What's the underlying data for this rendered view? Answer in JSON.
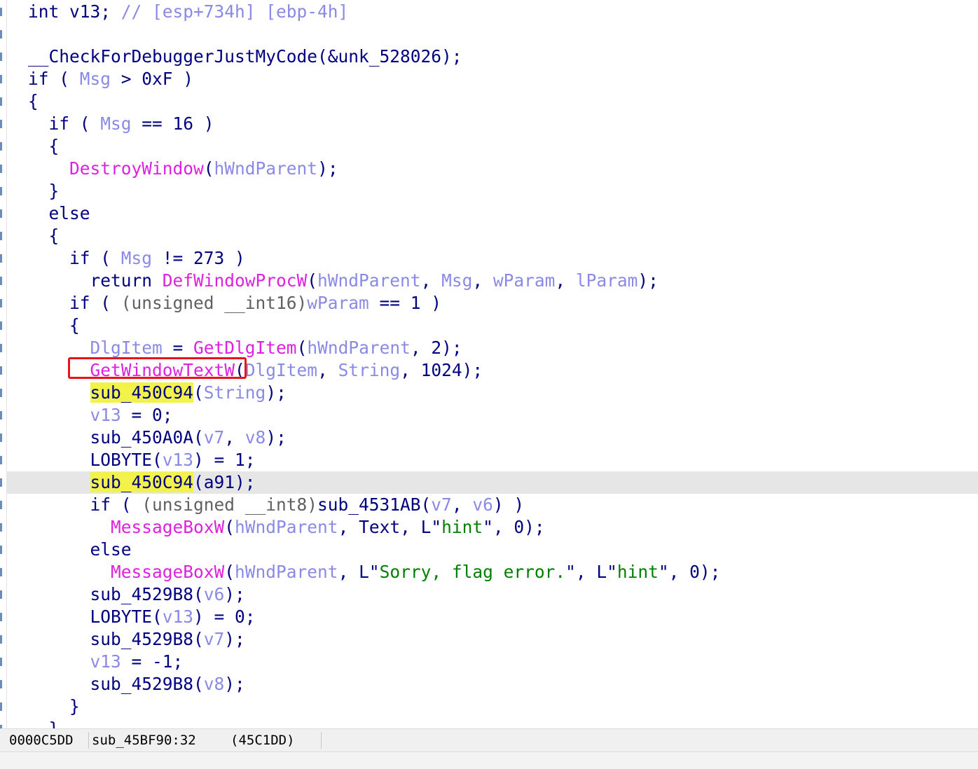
{
  "pseudocode": {
    "lines": [
      {
        "tokens": [
          {
            "t": "int v13; ",
            "c": "kw"
          },
          {
            "t": "// [esp+734h] [ebp-4h]",
            "c": "comment"
          }
        ]
      },
      {
        "tokens": []
      },
      {
        "tokens": [
          {
            "t": "__CheckForDebuggerJustMyCode(&unk_528026);",
            "c": "name"
          }
        ]
      },
      {
        "tokens": [
          {
            "t": "if ( ",
            "c": "kw"
          },
          {
            "t": "Msg",
            "c": "local"
          },
          {
            "t": " > 0xF )",
            "c": "kw"
          }
        ]
      },
      {
        "tokens": [
          {
            "t": "{",
            "c": "kw"
          }
        ]
      },
      {
        "tokens": [
          {
            "t": "  if ( ",
            "c": "kw"
          },
          {
            "t": "Msg",
            "c": "local"
          },
          {
            "t": " == 16 )",
            "c": "kw"
          }
        ]
      },
      {
        "tokens": [
          {
            "t": "  {",
            "c": "kw"
          }
        ]
      },
      {
        "tokens": [
          {
            "t": "    ",
            "c": "kw"
          },
          {
            "t": "DestroyWindow",
            "c": "func"
          },
          {
            "t": "(",
            "c": "kw"
          },
          {
            "t": "hWndParent",
            "c": "local"
          },
          {
            "t": ");",
            "c": "kw"
          }
        ]
      },
      {
        "tokens": [
          {
            "t": "  }",
            "c": "kw"
          }
        ]
      },
      {
        "tokens": [
          {
            "t": "  else",
            "c": "kw"
          }
        ]
      },
      {
        "tokens": [
          {
            "t": "  {",
            "c": "kw"
          }
        ]
      },
      {
        "tokens": [
          {
            "t": "    if ( ",
            "c": "kw"
          },
          {
            "t": "Msg",
            "c": "local"
          },
          {
            "t": " != 273 )",
            "c": "kw"
          }
        ]
      },
      {
        "tokens": [
          {
            "t": "      return ",
            "c": "kw"
          },
          {
            "t": "DefWindowProcW",
            "c": "func"
          },
          {
            "t": "(",
            "c": "kw"
          },
          {
            "t": "hWndParent",
            "c": "local"
          },
          {
            "t": ", ",
            "c": "kw"
          },
          {
            "t": "Msg",
            "c": "local"
          },
          {
            "t": ", ",
            "c": "kw"
          },
          {
            "t": "wParam",
            "c": "local"
          },
          {
            "t": ", ",
            "c": "kw"
          },
          {
            "t": "lParam",
            "c": "local"
          },
          {
            "t": ");",
            "c": "kw"
          }
        ]
      },
      {
        "tokens": [
          {
            "t": "    if ( ",
            "c": "kw"
          },
          {
            "t": "(unsigned __int16)",
            "c": "type"
          },
          {
            "t": "wParam",
            "c": "local"
          },
          {
            "t": " == 1 )",
            "c": "kw"
          }
        ]
      },
      {
        "tokens": [
          {
            "t": "    {",
            "c": "kw"
          }
        ]
      },
      {
        "tokens": [
          {
            "t": "      ",
            "c": "kw"
          },
          {
            "t": "DlgItem",
            "c": "local"
          },
          {
            "t": " = ",
            "c": "kw"
          },
          {
            "t": "GetDlgItem",
            "c": "func"
          },
          {
            "t": "(",
            "c": "kw"
          },
          {
            "t": "hWndParent",
            "c": "local"
          },
          {
            "t": ", 2);",
            "c": "kw"
          }
        ]
      },
      {
        "tokens": [
          {
            "t": "      ",
            "c": "kw"
          },
          {
            "t": "GetWindowTextW",
            "c": "func"
          },
          {
            "t": "(",
            "c": "kw"
          },
          {
            "t": "DlgItem",
            "c": "local"
          },
          {
            "t": ", ",
            "c": "kw"
          },
          {
            "t": "String",
            "c": "local"
          },
          {
            "t": ", 1024);",
            "c": "kw"
          }
        ]
      },
      {
        "tokens": [
          {
            "t": "      ",
            "c": "kw"
          },
          {
            "t": "sub_450C94",
            "c": "hl"
          },
          {
            "t": "(",
            "c": "kw"
          },
          {
            "t": "String",
            "c": "local"
          },
          {
            "t": ");",
            "c": "kw"
          }
        ]
      },
      {
        "tokens": [
          {
            "t": "      ",
            "c": "kw"
          },
          {
            "t": "v13",
            "c": "local"
          },
          {
            "t": " = 0;",
            "c": "kw"
          }
        ]
      },
      {
        "tokens": [
          {
            "t": "      sub_450A0A(",
            "c": "kw"
          },
          {
            "t": "v7",
            "c": "local"
          },
          {
            "t": ", ",
            "c": "kw"
          },
          {
            "t": "v8",
            "c": "local"
          },
          {
            "t": ");",
            "c": "kw"
          }
        ]
      },
      {
        "tokens": [
          {
            "t": "      LOBYTE(",
            "c": "kw"
          },
          {
            "t": "v13",
            "c": "local"
          },
          {
            "t": ") = 1;",
            "c": "kw"
          }
        ]
      },
      {
        "tokens": [
          {
            "t": "      ",
            "c": "kw"
          },
          {
            "t": "sub_450C94",
            "c": "hl"
          },
          {
            "t": "(a91);",
            "c": "kw"
          }
        ],
        "current": true
      },
      {
        "tokens": [
          {
            "t": "      if ( ",
            "c": "kw"
          },
          {
            "t": "(unsigned __int8)",
            "c": "type"
          },
          {
            "t": "sub_4531AB(",
            "c": "kw"
          },
          {
            "t": "v7",
            "c": "local"
          },
          {
            "t": ", ",
            "c": "kw"
          },
          {
            "t": "v6",
            "c": "local"
          },
          {
            "t": ") )",
            "c": "kw"
          }
        ]
      },
      {
        "tokens": [
          {
            "t": "        ",
            "c": "kw"
          },
          {
            "t": "MessageBoxW",
            "c": "func"
          },
          {
            "t": "(",
            "c": "kw"
          },
          {
            "t": "hWndParent",
            "c": "local"
          },
          {
            "t": ", Text, L\"",
            "c": "kw"
          },
          {
            "t": "hint",
            "c": "str"
          },
          {
            "t": "\", 0);",
            "c": "kw"
          }
        ]
      },
      {
        "tokens": [
          {
            "t": "      else",
            "c": "kw"
          }
        ]
      },
      {
        "tokens": [
          {
            "t": "        ",
            "c": "kw"
          },
          {
            "t": "MessageBoxW",
            "c": "func"
          },
          {
            "t": "(",
            "c": "kw"
          },
          {
            "t": "hWndParent",
            "c": "local"
          },
          {
            "t": ", L\"",
            "c": "kw"
          },
          {
            "t": "Sorry, flag error.",
            "c": "str"
          },
          {
            "t": "\", L\"",
            "c": "kw"
          },
          {
            "t": "hint",
            "c": "str"
          },
          {
            "t": "\", 0);",
            "c": "kw"
          }
        ]
      },
      {
        "tokens": [
          {
            "t": "      sub_4529B8(",
            "c": "kw"
          },
          {
            "t": "v6",
            "c": "local"
          },
          {
            "t": ");",
            "c": "kw"
          }
        ]
      },
      {
        "tokens": [
          {
            "t": "      LOBYTE(",
            "c": "kw"
          },
          {
            "t": "v13",
            "c": "local"
          },
          {
            "t": ") = 0;",
            "c": "kw"
          }
        ]
      },
      {
        "tokens": [
          {
            "t": "      sub_4529B8(",
            "c": "kw"
          },
          {
            "t": "v7",
            "c": "local"
          },
          {
            "t": ");",
            "c": "kw"
          }
        ]
      },
      {
        "tokens": [
          {
            "t": "      ",
            "c": "kw"
          },
          {
            "t": "v13",
            "c": "local"
          },
          {
            "t": " = -1;",
            "c": "kw"
          }
        ]
      },
      {
        "tokens": [
          {
            "t": "      sub_4529B8(",
            "c": "kw"
          },
          {
            "t": "v8",
            "c": "local"
          },
          {
            "t": ");",
            "c": "kw"
          }
        ]
      },
      {
        "tokens": [
          {
            "t": "    }",
            "c": "kw"
          }
        ]
      },
      {
        "tokens": [
          {
            "t": "  }",
            "c": "kw"
          }
        ]
      }
    ]
  },
  "status": {
    "offset": "0000C5DD",
    "location": "sub_45BF90:32",
    "address": "(45C1DD)"
  },
  "colors": {
    "annotation_box": "#e8141b",
    "highlight": "#f2f24b",
    "current_line": "#e6e6e6"
  }
}
